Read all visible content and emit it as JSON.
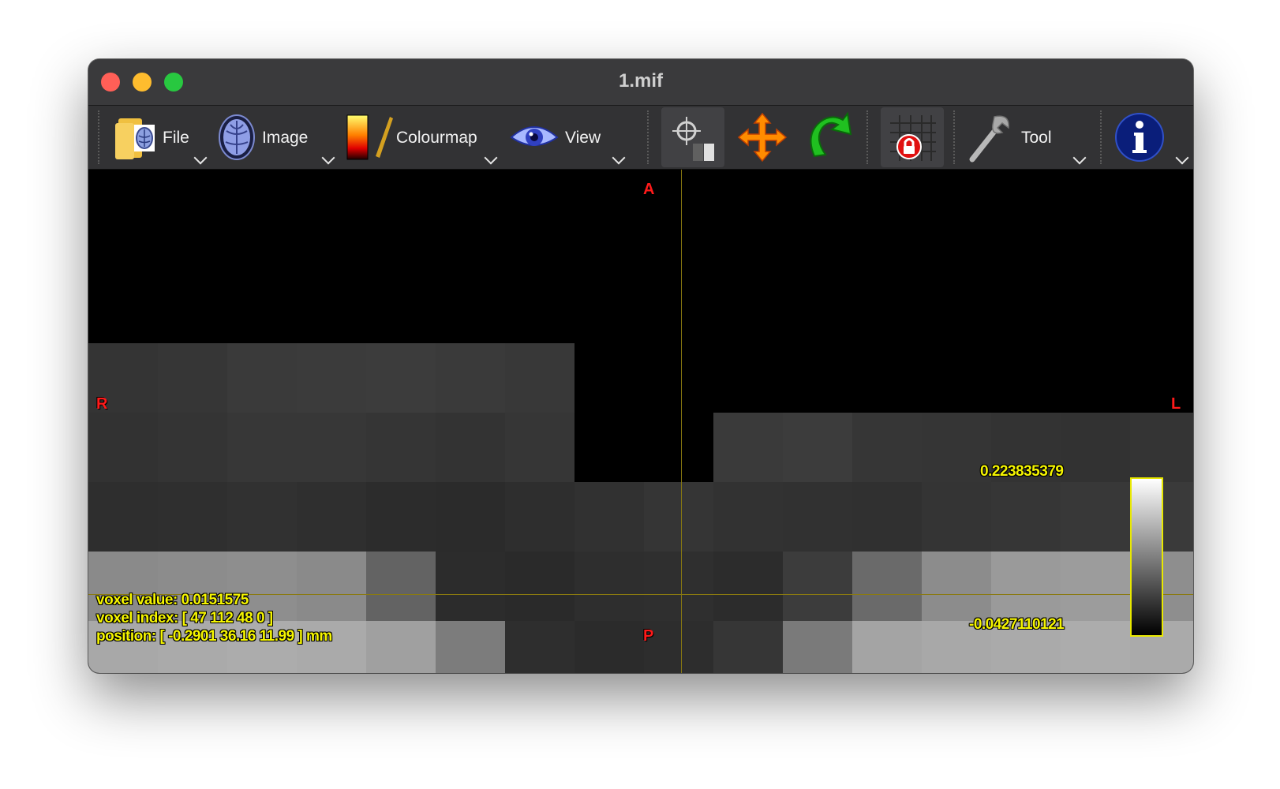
{
  "window": {
    "title": "1.mif"
  },
  "toolbar": {
    "file_label": "File",
    "image_label": "Image",
    "colourmap_label": "Colourmap",
    "view_label": "View",
    "tool_label": "Tool",
    "icons": [
      "file-icon",
      "image-icon",
      "colourmap-icon",
      "view-icon",
      "focus-contrast-icon",
      "move-icon",
      "rotate-icon",
      "lock-grid-icon",
      "wrench-icon",
      "info-icon"
    ]
  },
  "viewport": {
    "orientation": {
      "top": "A",
      "bottom": "P",
      "left": "R",
      "right": "L"
    },
    "voxel_value": "voxel value: 0.0151575",
    "voxel_index": "voxel index: [ 47 112 48 0 ]",
    "position": "position: [ -0.2901 36.16 11.99 ] mm",
    "colorbar_max": "0.223835379",
    "colorbar_min": "-0.0427110121",
    "colorbar_color": "#e8e800",
    "crosshair_color": "#8a7a10",
    "overlay_text_color": "#f5f500"
  }
}
